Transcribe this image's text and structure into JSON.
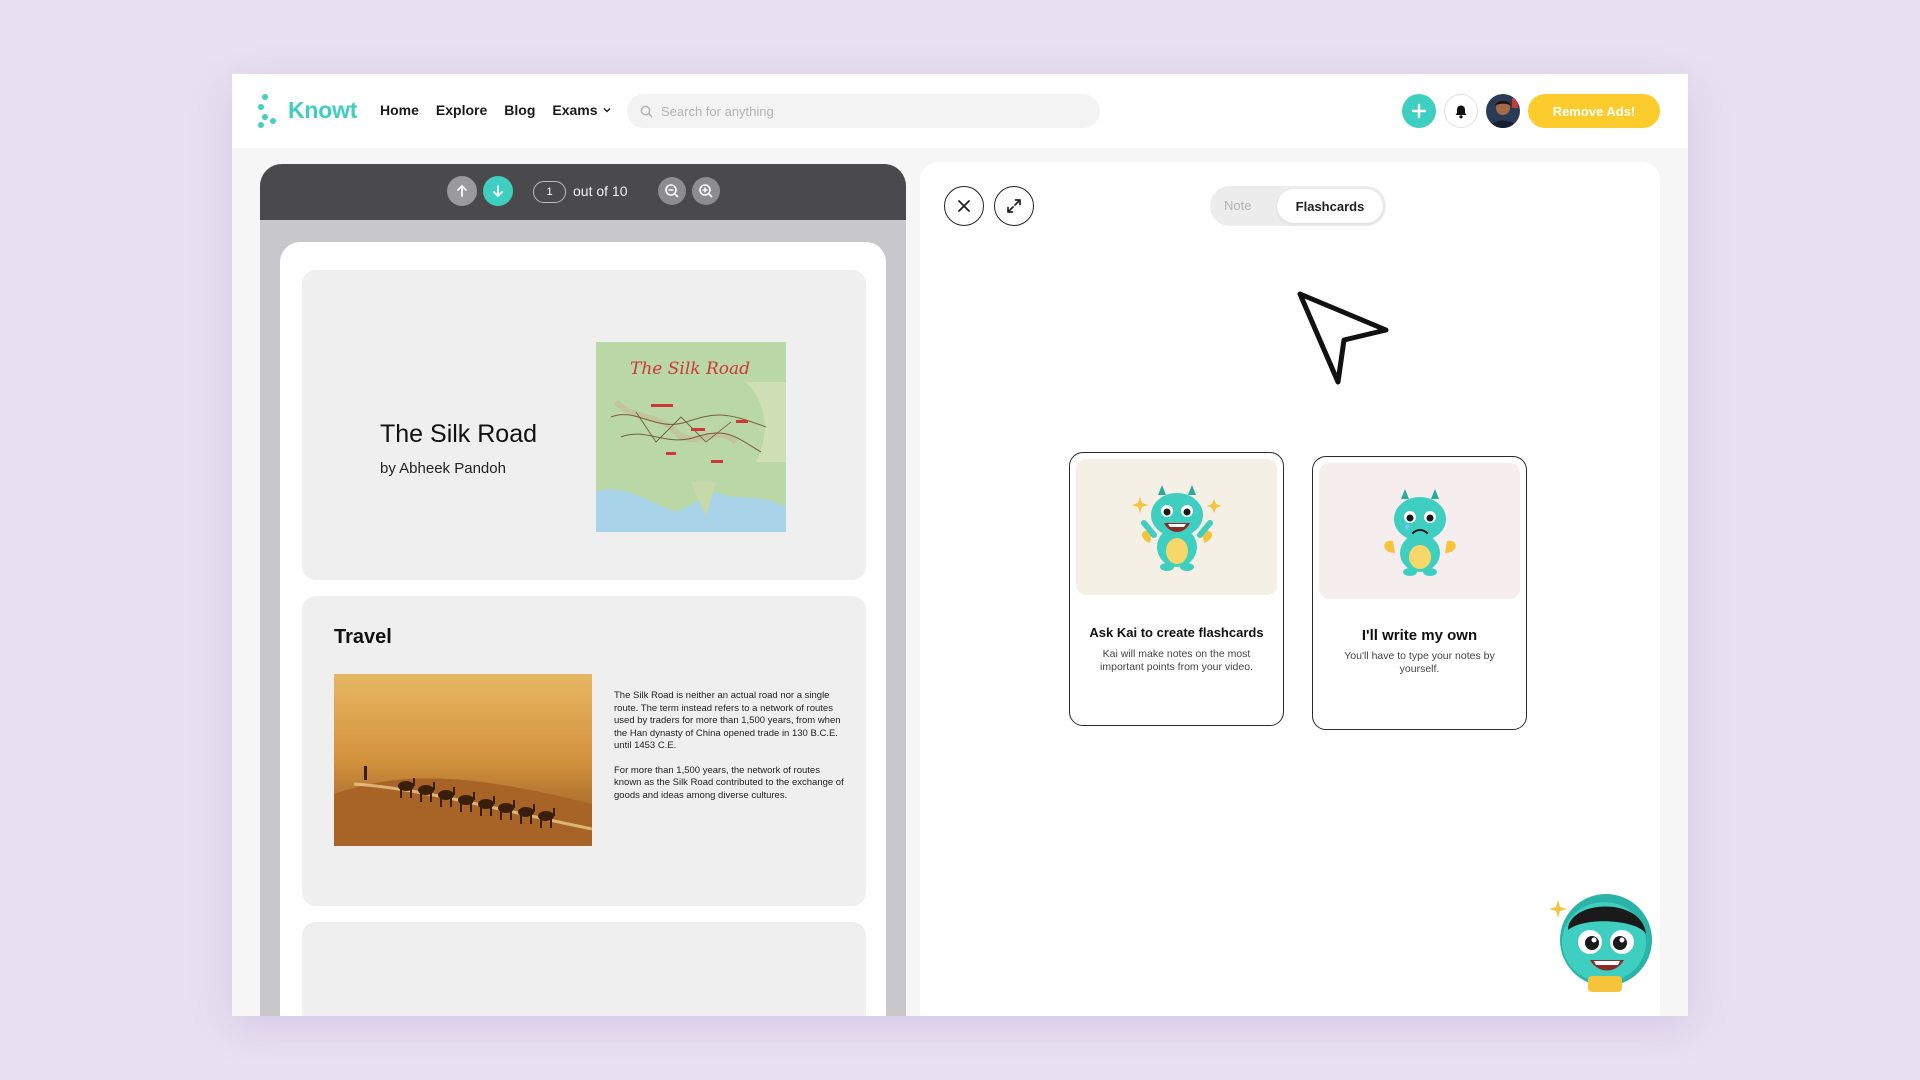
{
  "brand": {
    "name": "Knowt",
    "accent": "#3fcfc1",
    "yellow": "#fccb2c"
  },
  "nav": {
    "home": "Home",
    "explore": "Explore",
    "blog": "Blog",
    "exams": "Exams"
  },
  "search": {
    "placeholder": "Search for anything"
  },
  "header": {
    "remove_ads": "Remove Ads!"
  },
  "viewer": {
    "current_page": "1",
    "page_total": "out of 10",
    "slides": {
      "title": "The Silk Road",
      "author": "by Abheek Pandoh",
      "map_title": "The Silk Road",
      "travel_title": "Travel",
      "travel_p1": "The Silk Road is neither an actual road nor a single route. The term instead refers to a network of routes used by traders for more than 1,500 years, from when the Han dynasty of China opened trade in 130 B.C.E. until 1453 C.E.",
      "travel_p2": "For more than 1,500 years, the network of routes known as the Silk Road contributed to the exchange of goods and ideas among diverse cultures."
    }
  },
  "panel": {
    "tab_note": "Note",
    "tab_flashcards": "Flashcards",
    "option_ai_title": "Ask Kai to create flashcards",
    "option_ai_desc": "Kai will make notes on the most important points from your video.",
    "option_own_title": "I'll write my own",
    "option_own_desc": "You'll have to type your notes by yourself."
  }
}
